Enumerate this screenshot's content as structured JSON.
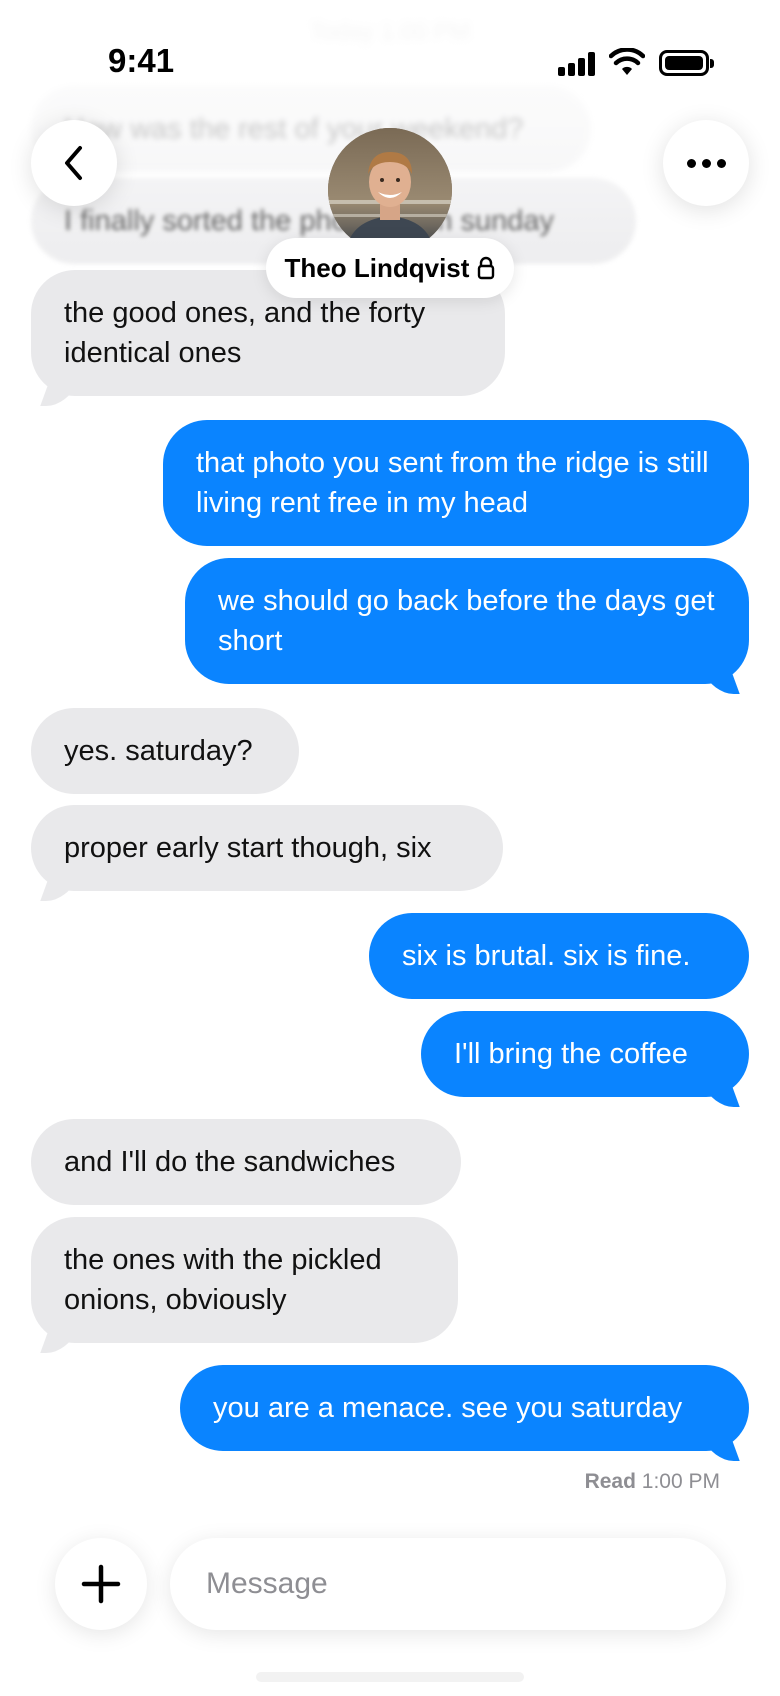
{
  "status_bar": {
    "time": "9:41"
  },
  "header": {
    "contact_name": "Theo Lindqvist",
    "date_label": "Today 1:00 PM",
    "back_icon": "chevron-left-icon",
    "more_icon": "ellipsis-icon",
    "lock_icon": "lock-icon"
  },
  "messages": [
    {
      "from": "them",
      "text": "How was the rest of your weekend?"
    },
    {
      "from": "them",
      "text": "I finally sorted the photos from sunday"
    },
    {
      "from": "them",
      "text": "the good ones, and the forty identical ones"
    },
    {
      "from": "me",
      "text": "that photo you sent from the ridge is still living rent free in my head"
    },
    {
      "from": "me",
      "text": "we should go back before the days get short"
    },
    {
      "from": "them",
      "text": "yes. saturday?"
    },
    {
      "from": "them",
      "text": "proper early start though, six"
    },
    {
      "from": "me",
      "text": "six is brutal. six is fine."
    },
    {
      "from": "me",
      "text": "I'll bring the coffee"
    },
    {
      "from": "them",
      "text": "and I'll do the sandwiches"
    },
    {
      "from": "them",
      "text": "the ones with the pickled onions, obviously"
    },
    {
      "from": "me",
      "text": "you are a menace. see you saturday"
    }
  ],
  "receipt": {
    "label": "Read",
    "time": "1:00 PM"
  },
  "composer": {
    "placeholder": "Message",
    "plus_icon": "plus-icon"
  },
  "colors": {
    "outgoing": "#0a84ff",
    "incoming": "#e9e9eb"
  }
}
